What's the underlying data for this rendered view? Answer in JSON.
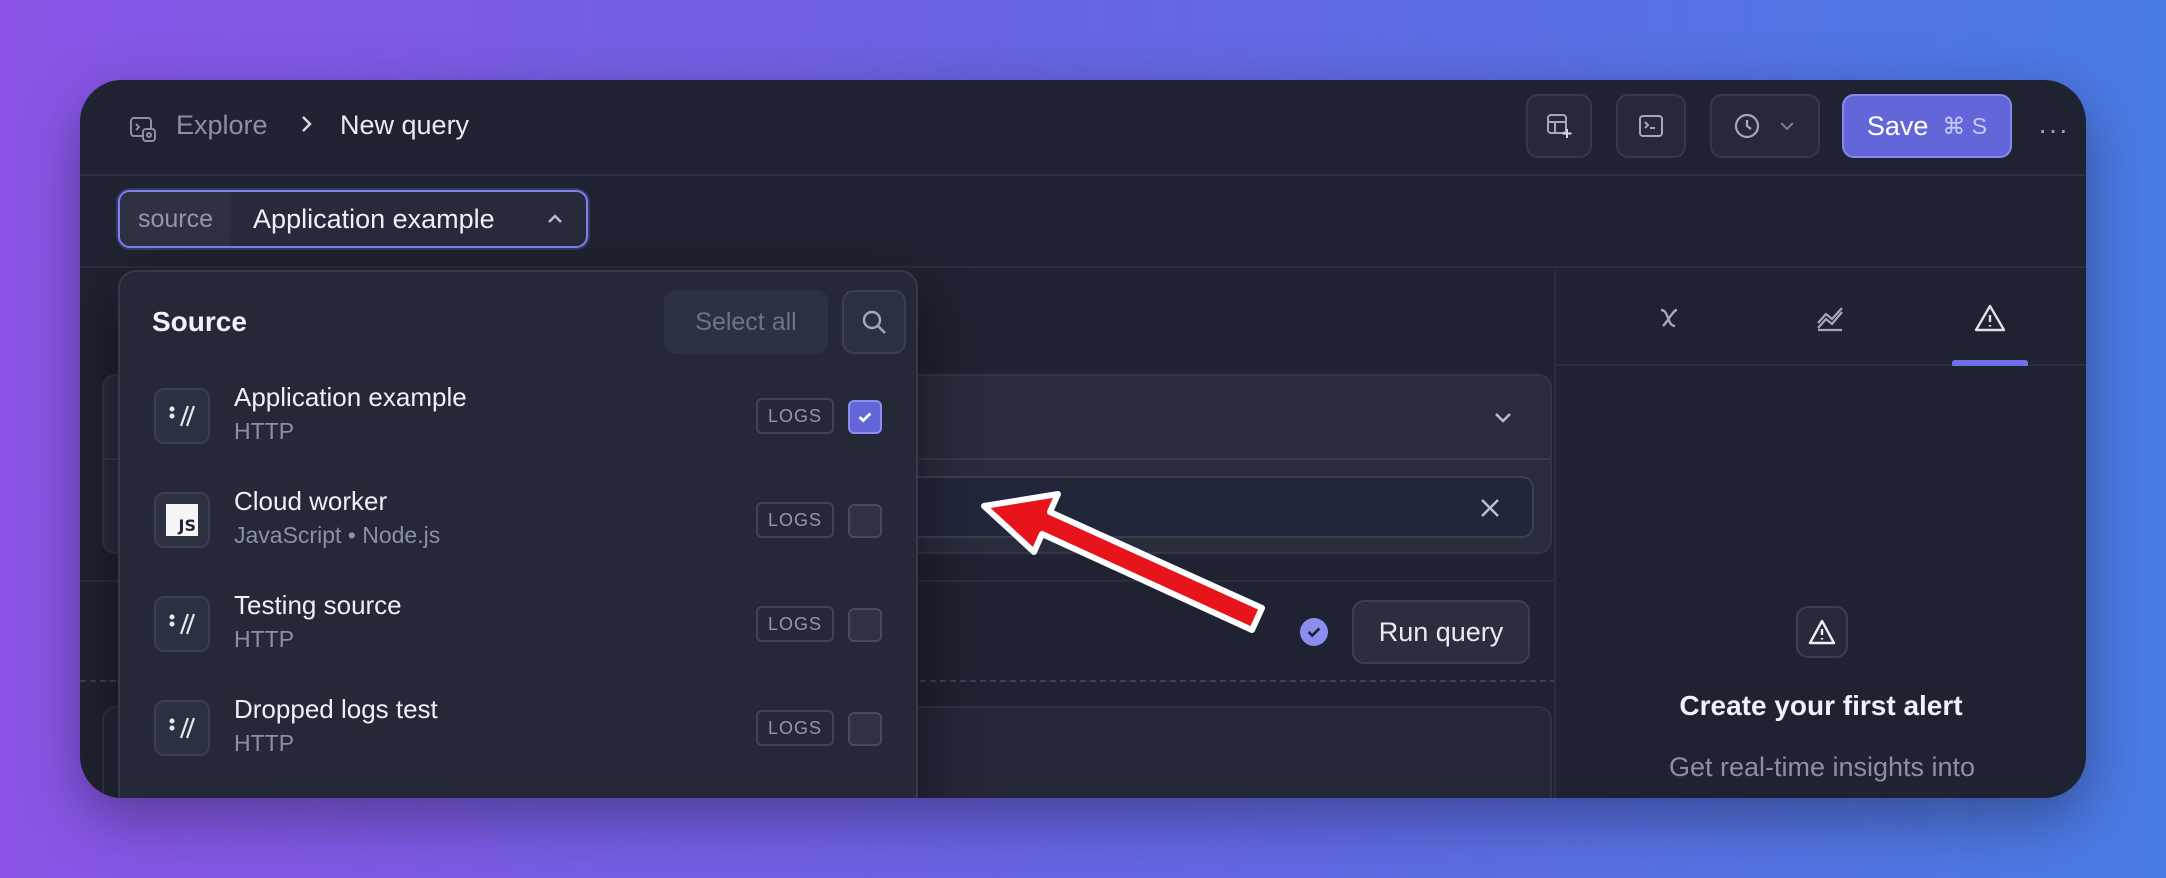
{
  "breadcrumb": {
    "root": "Explore",
    "current": "New query"
  },
  "toolbar": {
    "save_label": "Save",
    "save_shortcut": "⌘ S",
    "more": "···"
  },
  "source_filter": {
    "key": "source",
    "value": "Application example"
  },
  "dropdown": {
    "title": "Source",
    "select_all": "Select all",
    "items": [
      {
        "name": "Application example",
        "sub": "HTTP",
        "badge": "LOGS",
        "checked": true,
        "icon": "http-icon"
      },
      {
        "name": "Cloud worker",
        "sub": "JavaScript • Node.js",
        "badge": "LOGS",
        "checked": false,
        "icon": "js-icon"
      },
      {
        "name": "Testing source",
        "sub": "HTTP",
        "badge": "LOGS",
        "checked": false,
        "icon": "http-icon"
      },
      {
        "name": "Dropped logs test",
        "sub": "HTTP",
        "badge": "LOGS",
        "checked": false,
        "icon": "http-icon"
      }
    ]
  },
  "query": {
    "run_label": "Run query"
  },
  "right_panel": {
    "tabs": [
      "variables-icon",
      "chart-icon",
      "alert-icon"
    ],
    "active_tab": "alert-icon",
    "empty_title": "Create your first alert",
    "empty_desc": "Get real-time insights into how your data is evolving over time"
  },
  "colors": {
    "accent": "#6366d8",
    "background": "#1f2230",
    "annotation_arrow": "#e8141c"
  }
}
